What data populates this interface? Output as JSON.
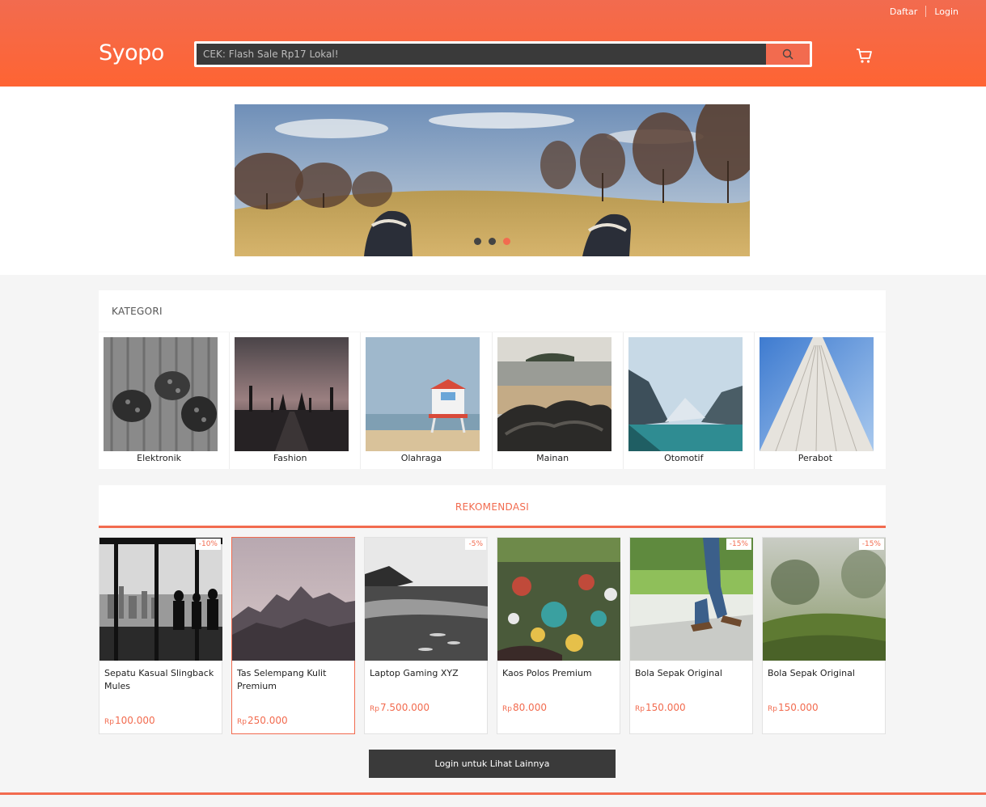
{
  "header": {
    "logo": "Syopo",
    "links": {
      "register": "Daftar",
      "login": "Login"
    },
    "search": {
      "placeholder": "CEK: Flash Sale Rp17 Lokal!",
      "value": ""
    }
  },
  "banner": {
    "slides": 3,
    "active_slide": 3
  },
  "categories": {
    "title": "KATEGORI",
    "items": [
      {
        "label": "Elektronik"
      },
      {
        "label": "Fashion"
      },
      {
        "label": "Olahraga"
      },
      {
        "label": "Mainan"
      },
      {
        "label": "Otomotif"
      },
      {
        "label": "Perabot"
      }
    ]
  },
  "recommend": {
    "title": "REKOMENDASI",
    "currency": "Rp",
    "products": [
      {
        "name": "Sepatu Kasual Slingback Mules",
        "price": "100.000",
        "discount": "-10%"
      },
      {
        "name": "Tas Selempang Kulit Premium",
        "price": "250.000",
        "discount": ""
      },
      {
        "name": "Laptop Gaming XYZ",
        "price": "7.500.000",
        "discount": "-5%"
      },
      {
        "name": "Kaos Polos Premium",
        "price": "80.000",
        "discount": ""
      },
      {
        "name": "Bola Sepak Original",
        "price": "150.000",
        "discount": "-15%"
      },
      {
        "name": "Bola Sepak Original",
        "price": "150.000",
        "discount": "-15%"
      }
    ],
    "more_button": "Login untuk Lihat Lainnya"
  },
  "colors": {
    "accent": "#f26b4f",
    "dark": "#3a3a3a",
    "background": "#f5f5f5"
  },
  "icons": {
    "search": "search-icon",
    "cart": "cart-icon"
  }
}
